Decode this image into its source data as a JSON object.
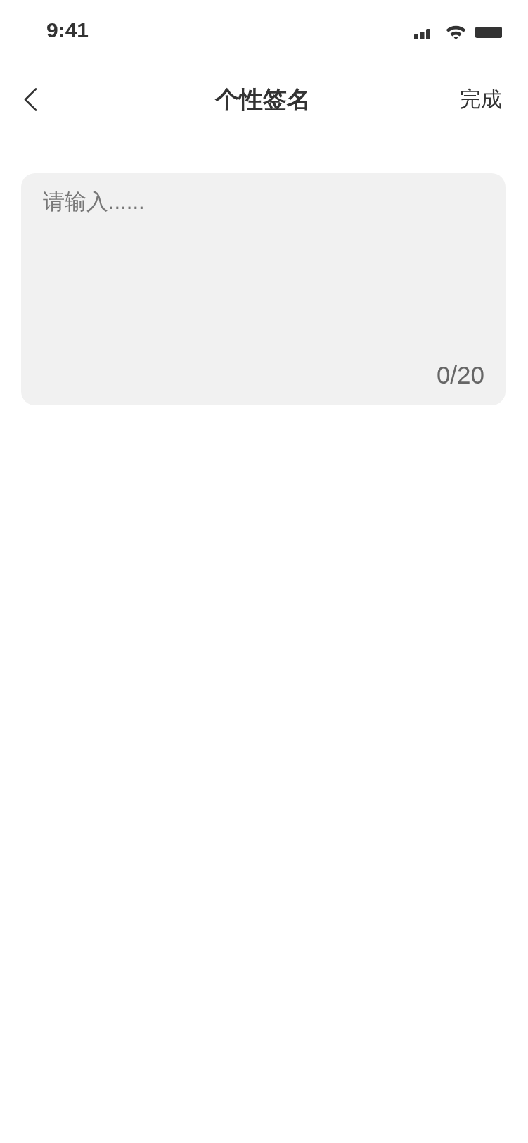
{
  "status_bar": {
    "time": "9:41"
  },
  "nav": {
    "title": "个性签名",
    "action": "完成"
  },
  "signature": {
    "placeholder": "请输入......",
    "counter": "0/20"
  }
}
